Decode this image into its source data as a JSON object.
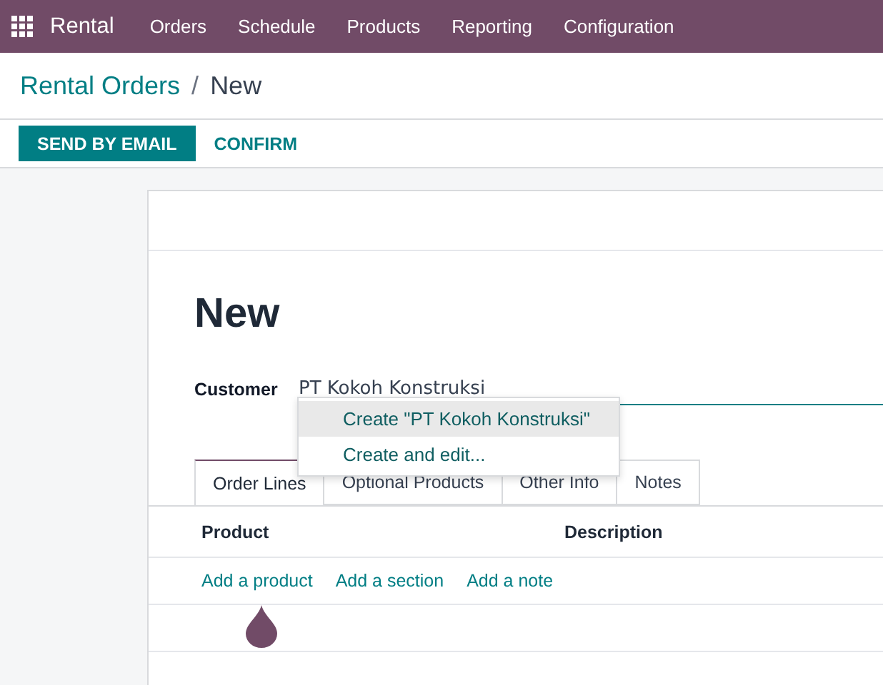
{
  "navbar": {
    "app_name": "Rental",
    "menu": [
      "Orders",
      "Schedule",
      "Products",
      "Reporting",
      "Configuration"
    ]
  },
  "breadcrumb": {
    "parent": "Rental Orders",
    "separator": "/",
    "current": "New"
  },
  "buttons": [
    {
      "label": "SEND BY EMAIL",
      "kind": "primary"
    },
    {
      "label": "CONFIRM",
      "kind": "secondary"
    }
  ],
  "form": {
    "title": "New",
    "customer": {
      "label": "Customer",
      "value": "PT Kokoh Konstruksi"
    },
    "dropdown": [
      {
        "label": "Create \"PT Kokoh Konstruksi\"",
        "selected": true
      },
      {
        "label": "Create and edit...",
        "selected": false
      }
    ],
    "tabs": [
      {
        "label": "Order Lines",
        "selected": true
      },
      {
        "label": "Optional Products",
        "selected": false
      },
      {
        "label": "Other Info",
        "selected": false
      },
      {
        "label": "Notes",
        "selected": false
      }
    ],
    "table": {
      "columns": [
        "Product",
        "Description"
      ],
      "actions": [
        "Add a product",
        "Add a section",
        "Add a note"
      ]
    }
  }
}
